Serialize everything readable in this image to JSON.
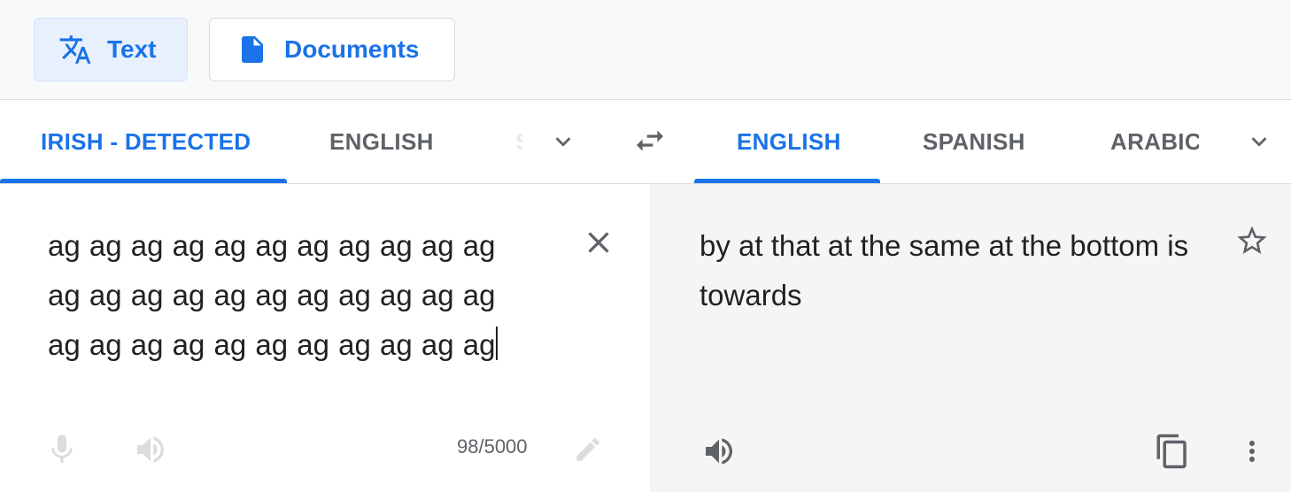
{
  "modes": {
    "text_label": "Text",
    "documents_label": "Documents",
    "text_icon": "translate-icon",
    "documents_icon": "document-icon"
  },
  "source_languages": {
    "tabs": [
      {
        "label": "IRISH - DETECTED",
        "active": true
      },
      {
        "label": "ENGLISH",
        "active": false
      },
      {
        "label": "S",
        "active": false
      }
    ],
    "more_icon": "chevron-down-icon"
  },
  "swap_icon": "swap-arrows-icon",
  "target_languages": {
    "tabs": [
      {
        "label": "ENGLISH",
        "active": true
      },
      {
        "label": "SPANISH",
        "active": false
      },
      {
        "label": "ARABIC",
        "active": false
      }
    ],
    "more_icon": "chevron-down-icon"
  },
  "source": {
    "text": "ag ag ag ag ag ag ag ag ag ag ag ag ag ag ag ag ag ag ag ag ag ag ag ag ag ag ag ag ag ag ag ag ag",
    "char_count": "98/5000",
    "clear_icon": "close-icon",
    "mic_icon": "microphone-icon",
    "speaker_icon": "speaker-icon",
    "edit_icon": "pencil-icon"
  },
  "target": {
    "text": "by at that at the same at the bottom is towards",
    "star_icon": "star-icon",
    "speaker_icon": "speaker-icon",
    "copy_icon": "copy-icon",
    "more_icon": "more-vert-icon"
  },
  "colors": {
    "accent": "#1a73e8",
    "muted": "#5f6368",
    "disabled": "#bdc1c6",
    "target_bg": "#f5f5f5"
  }
}
